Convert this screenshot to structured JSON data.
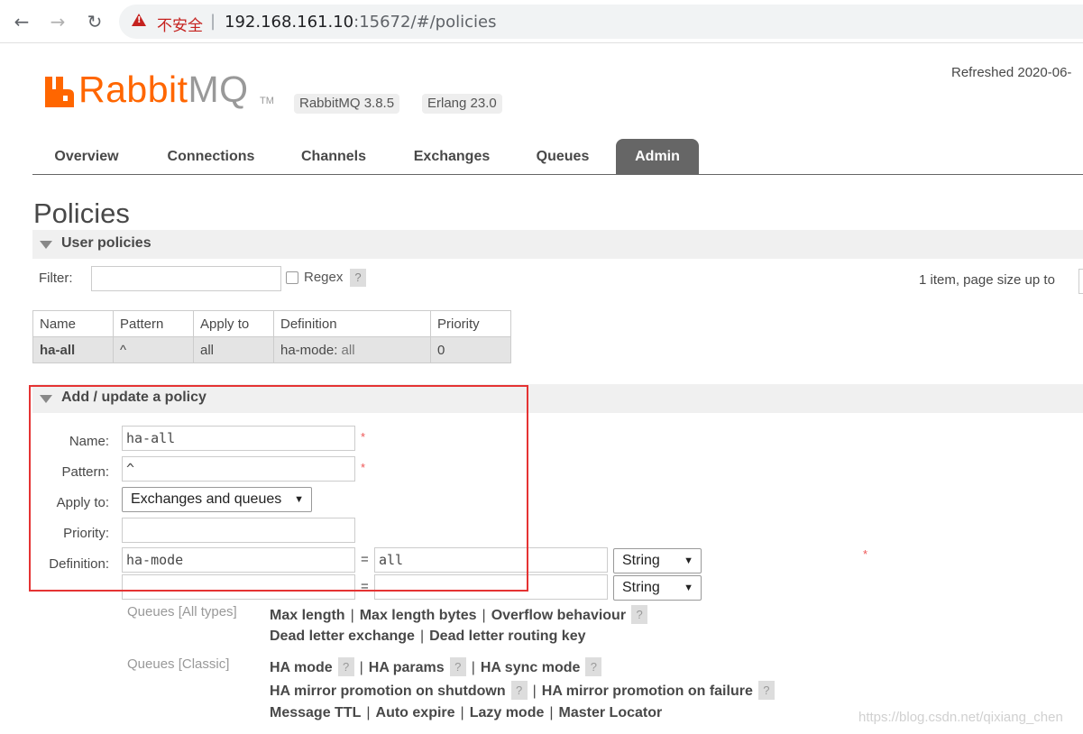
{
  "browser": {
    "insecure_label": "不安全",
    "url_host": "192.168.161.10",
    "url_rest": ":15672/#/policies"
  },
  "header": {
    "logo_rabbit": "Rabbit",
    "logo_mq": "MQ",
    "logo_tm": "TM",
    "rabbit_version": "RabbitMQ 3.8.5",
    "erlang_version": "Erlang 23.0",
    "refreshed": "Refreshed 2020-06-",
    "brand_color": "#ff6600"
  },
  "tabs": [
    {
      "label": "Overview",
      "active": false
    },
    {
      "label": "Connections",
      "active": false
    },
    {
      "label": "Channels",
      "active": false
    },
    {
      "label": "Exchanges",
      "active": false
    },
    {
      "label": "Queues",
      "active": false
    },
    {
      "label": "Admin",
      "active": true
    }
  ],
  "page": {
    "title": "Policies",
    "user_policies_label": "User policies",
    "add_policy_label": "Add / update a policy"
  },
  "filter": {
    "label": "Filter:",
    "value": "",
    "regex_label": "Regex",
    "help": "?",
    "pager_text": "1 item, page size up to"
  },
  "policies_table": {
    "headers": [
      "Name",
      "Pattern",
      "Apply to",
      "Definition",
      "Priority"
    ],
    "rows": [
      {
        "name": "ha-all",
        "pattern": "^",
        "apply_to": "all",
        "def_key": "ha-mode:",
        "def_value": "all",
        "priority": "0"
      }
    ]
  },
  "form": {
    "name_label": "Name:",
    "name_value": "ha-all",
    "pattern_label": "Pattern:",
    "pattern_value": "^",
    "apply_to_label": "Apply to:",
    "apply_to_value": "Exchanges and queues",
    "priority_label": "Priority:",
    "priority_value": "",
    "definition_label": "Definition:",
    "required_mark": "*",
    "definitions": [
      {
        "key": "ha-mode",
        "value": "all",
        "type": "String"
      },
      {
        "key": "",
        "value": "",
        "type": "String"
      }
    ],
    "equals": "="
  },
  "hints": {
    "queues_all_label": "Queues [All types]",
    "queues_classic_label": "Queues [Classic]",
    "max_length": "Max length",
    "max_length_bytes": "Max length bytes",
    "overflow_behaviour": "Overflow behaviour",
    "dead_letter_exchange": "Dead letter exchange",
    "dead_letter_routing_key": "Dead letter routing key",
    "ha_mode": "HA mode",
    "ha_params": "HA params",
    "ha_sync_mode": "HA sync mode",
    "ha_promo_shutdown": "HA mirror promotion on shutdown",
    "ha_promo_failure": "HA mirror promotion on failure",
    "message_ttl": "Message TTL",
    "auto_expire": "Auto expire",
    "lazy_mode": "Lazy mode",
    "master_locator": "Master Locator",
    "sep": "|",
    "help": "?"
  },
  "watermark": "https://blog.csdn.net/qixiang_chen"
}
